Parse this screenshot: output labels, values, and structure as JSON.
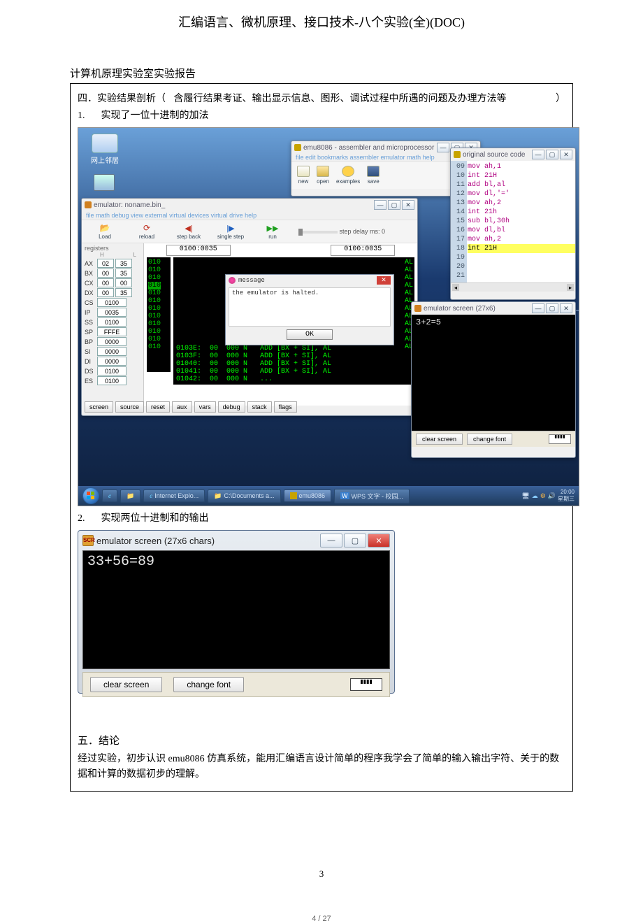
{
  "doc_title": "汇编语言、微机原理、接口技术-八个实验(全)(DOC)",
  "report_header": "计算机原理实验室实验报告",
  "section4": {
    "label": "四．实验结果剖析（",
    "note": "含履行结果考证、输出显示信息、图形、调试过程中所遇的问题及办理方法等",
    "close": "）"
  },
  "item1": {
    "num": "1.",
    "text": "实现了一位十进制的加法"
  },
  "item2": {
    "num": "2.",
    "text": "实现两位十进制和的输出"
  },
  "section5": {
    "label": "五．结论"
  },
  "conclusion_body": "经过实验，初步认识 emu8086 仿真系统，能用汇编语言设计简单的程序我学会了简单的输入输出字符、关于的数据和计算的数据初步的理解。",
  "page_inner": "3",
  "page_outer": "4 / 27",
  "desktop": {
    "icon1_label": "网上邻居"
  },
  "emu_main": {
    "title": "emu8086 - assembler and microprocessor",
    "menu": "file  edit  bookmarks  assembler  emulator  math  help",
    "btn_new": "new",
    "btn_open": "open",
    "btn_examples": "examples",
    "btn_save": "save"
  },
  "source_win": {
    "title": "original source code",
    "lines": [
      "mov ah,1",
      "int 21H",
      "",
      "add bl,al",
      "mov dl,'='",
      "mov ah,2",
      "int 21h",
      "",
      "sub bl,30h",
      "",
      "mov dl,bl",
      "mov ah,2",
      "int 21H"
    ],
    "gutter": [
      "09",
      "10",
      "11",
      "12",
      "13",
      "14",
      "15",
      "16",
      "17",
      "18",
      "19",
      "20",
      "21"
    ]
  },
  "emulator": {
    "title": "emulator: noname.bin_",
    "menu": "file  math  debug  view  external  virtual devices  virtual drive  help",
    "btn_load": "Load",
    "btn_reload": "reload",
    "btn_back": "step back",
    "btn_step": "single step",
    "btn_run": "run",
    "delay": "step delay ms: 0",
    "regs_hdr": "registers",
    "H": "H",
    "L": "L",
    "regs": [
      {
        "n": "AX",
        "h": "02",
        "l": "35"
      },
      {
        "n": "BX",
        "h": "00",
        "l": "35"
      },
      {
        "n": "CX",
        "h": "00",
        "l": "00"
      },
      {
        "n": "DX",
        "h": "00",
        "l": "35"
      }
    ],
    "wregs": [
      {
        "n": "CS",
        "v": "0100"
      },
      {
        "n": "IP",
        "v": "0035"
      },
      {
        "n": "SS",
        "v": "0100"
      },
      {
        "n": "SP",
        "v": "FFFE"
      },
      {
        "n": "BP",
        "v": "0000"
      },
      {
        "n": "SI",
        "v": "0000"
      },
      {
        "n": "DI",
        "v": "0000"
      },
      {
        "n": "DS",
        "v": "0100"
      },
      {
        "n": "ES",
        "v": "0100"
      }
    ],
    "addr1": "0100:0035",
    "addr2": "0100:0035",
    "disasm": [
      "0103E:  00  000 N   ADD [BX + SI], AL",
      "0103F:  00  000 N   ADD [BX + SI], AL",
      "01040:  00  000 N   ADD [BX + SI], AL",
      "01041:  00  000 N   ADD [BX + SI], AL",
      "01042:  00  000 N   ..."
    ],
    "al_col": [
      "AL",
      "AL",
      "AL",
      "AL",
      "AL",
      "AL",
      "AL",
      "AL",
      "AL",
      "AL",
      "AL",
      "AL"
    ],
    "msg_title": "message",
    "msg_body": "the emulator is halted.",
    "msg_ok": "OK",
    "bottom": [
      "screen",
      "source",
      "reset",
      "aux",
      "vars",
      "debug",
      "stack",
      "flags"
    ]
  },
  "screen_win": {
    "title": "emulator screen (27x6)",
    "output": "3+2=5",
    "btn_clear": "clear screen",
    "btn_font": "change font",
    "slot": "▮▮▮▮"
  },
  "taskbar": {
    "ie": "Internet Explo...",
    "docs": "C:\\Documents a...",
    "emu": "emu8086",
    "wps": "WPS 文字 - 校园...",
    "time": "20:00",
    "date": "星期三"
  },
  "shot2": {
    "title": "emulator screen (27x6 chars)",
    "output": "33+56=89",
    "btn_clear": "clear screen",
    "btn_font": "change font",
    "slot": "▮▮▮▮"
  }
}
